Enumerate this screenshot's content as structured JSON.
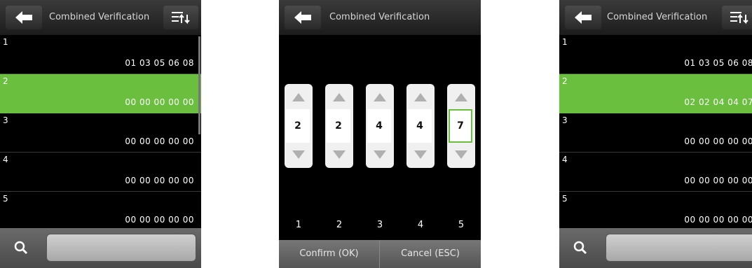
{
  "title": "Combined Verification",
  "left_list": [
    {
      "index": "1",
      "code": "01 03 05 06 08"
    },
    {
      "index": "2",
      "code": "00 00 00 00 00"
    },
    {
      "index": "3",
      "code": "00 00 00 00 00"
    },
    {
      "index": "4",
      "code": "00 00 00 00 00"
    },
    {
      "index": "5",
      "code": "00 00 00 00 00"
    }
  ],
  "editor": {
    "values": [
      "2",
      "2",
      "4",
      "4",
      "7"
    ],
    "columns": [
      "1",
      "2",
      "3",
      "4",
      "5"
    ],
    "confirm_label": "Confirm (OK)",
    "cancel_label": "Cancel (ESC)"
  },
  "right_list": [
    {
      "index": "1",
      "code": "01 03 05 06 08"
    },
    {
      "index": "2",
      "code": "02 02 04 04 07"
    },
    {
      "index": "3",
      "code": "00 00 00 00 00"
    },
    {
      "index": "4",
      "code": "00 00 00 00 00"
    },
    {
      "index": "5",
      "code": "00 00 00 00 00"
    }
  ],
  "search_value": "",
  "icons": {
    "back": "back-arrow-icon",
    "menu": "sort-menu-icon",
    "search": "search-icon",
    "up": "up-triangle-icon",
    "down": "down-triangle-icon"
  },
  "colors": {
    "selected": "#6bbf3f",
    "background": "#000000"
  }
}
